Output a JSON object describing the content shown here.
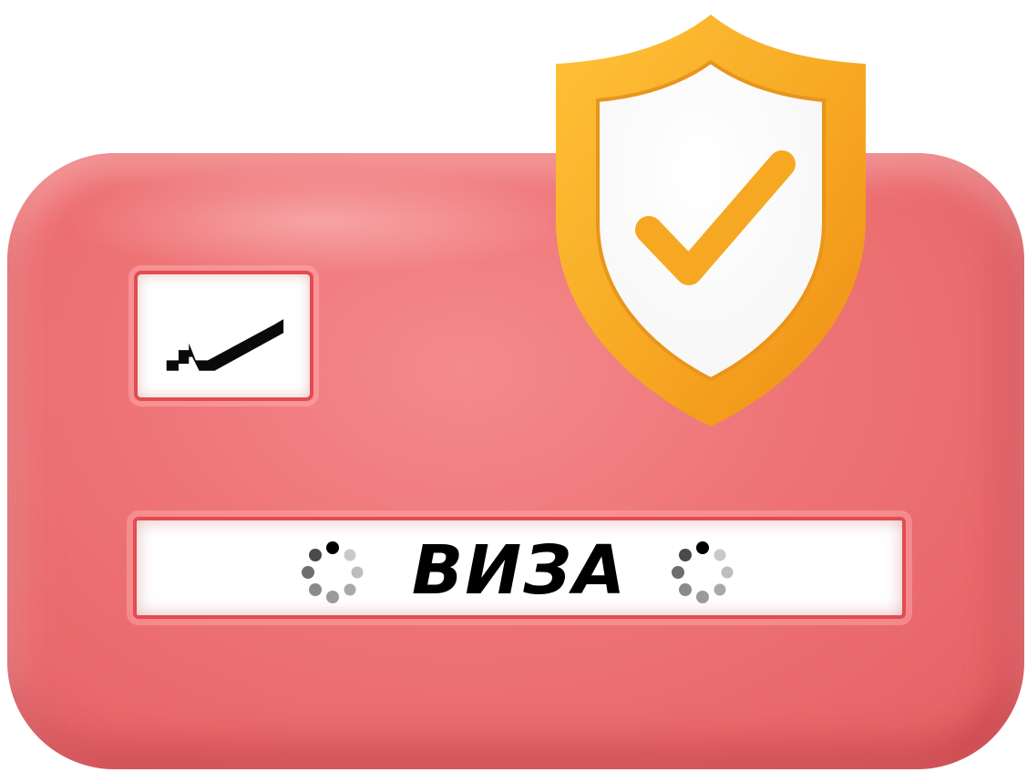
{
  "card": {
    "label": "ВИЗА"
  },
  "icons": {
    "logo": "stock-chart-icon",
    "shield": "shield-check-icon",
    "spinner_left": "loading-spinner-icon",
    "spinner_right": "loading-spinner-icon"
  },
  "colors": {
    "card": "#ee7375",
    "card_border": "#e24c52",
    "shield_outer": "#f7a823",
    "shield_inner": "#ffffff",
    "checkmark": "#f7a823",
    "text": "#000000"
  }
}
